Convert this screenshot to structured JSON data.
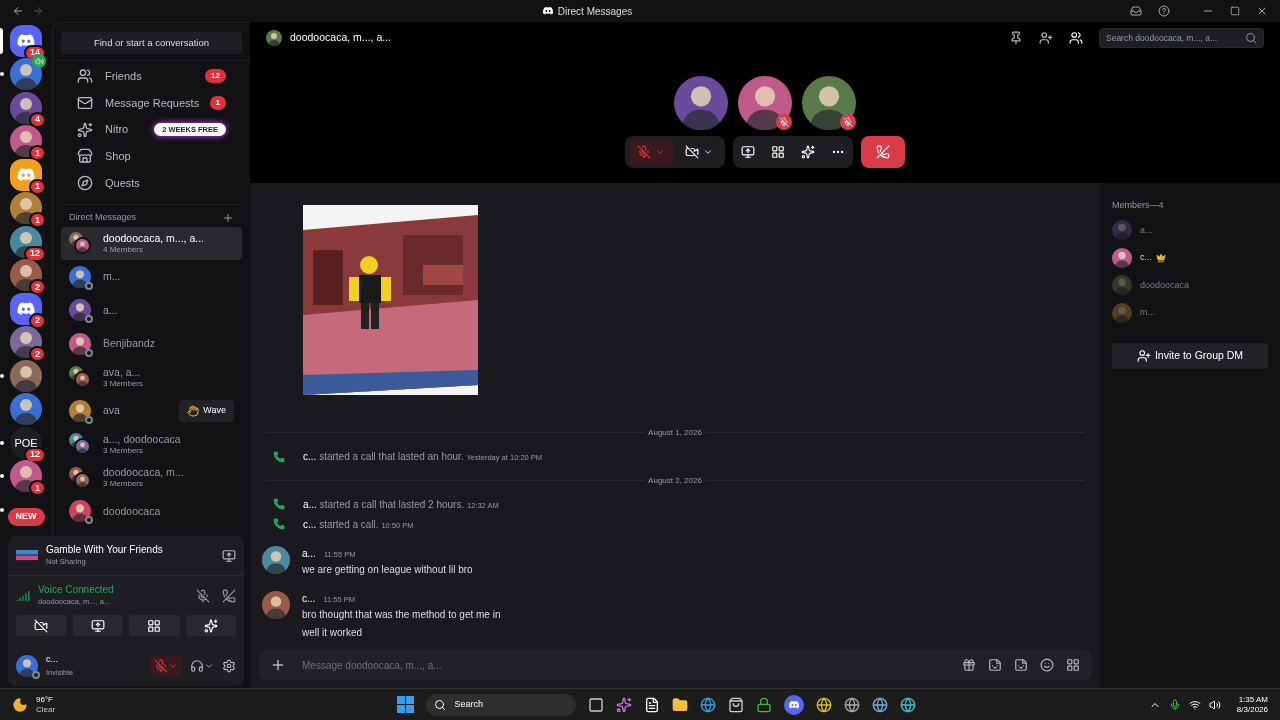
{
  "window": {
    "title": "Direct Messages"
  },
  "servers": [
    {
      "kind": "logo",
      "badge": "14",
      "selected": true,
      "unread": false
    },
    {
      "kind": "avatar",
      "selected": false,
      "unread": true,
      "speaking": true
    },
    {
      "kind": "avatar",
      "badge": "4",
      "selected": false,
      "unread": false
    },
    {
      "kind": "avatar",
      "badge": "1",
      "selected": false,
      "unread": false
    },
    {
      "kind": "logo",
      "badge": "1",
      "selected": false,
      "unread": false,
      "color": "#f0a020"
    },
    {
      "kind": "avatar",
      "badge": "1",
      "selected": false,
      "unread": false
    },
    {
      "kind": "avatar",
      "badge": "12",
      "selected": false,
      "unread": false
    },
    {
      "kind": "avatar",
      "badge": "2",
      "selected": false,
      "unread": false
    },
    {
      "kind": "logo",
      "badge": "2",
      "selected": false,
      "unread": false,
      "color": "#5865f2"
    },
    {
      "kind": "avatar",
      "badge": "2",
      "selected": false,
      "unread": false
    },
    {
      "kind": "avatar",
      "selected": false,
      "unread": true
    },
    {
      "kind": "avatar",
      "selected": false,
      "unread": false
    },
    {
      "kind": "text",
      "label": "POE",
      "badge": "12",
      "selected": false,
      "unread": true
    },
    {
      "kind": "avatar",
      "badge": "1",
      "selected": false,
      "unread": true
    },
    {
      "kind": "new",
      "label": "NEW",
      "selected": false,
      "unread": true
    }
  ],
  "find_button": "Find or start a conversation",
  "nav": [
    {
      "kind": "friends",
      "label": "Friends",
      "count": "12"
    },
    {
      "kind": "requests",
      "label": "Message Requests",
      "count": "1"
    },
    {
      "kind": "nitro",
      "label": "Nitro",
      "promo": "2 WEEKS FREE"
    },
    {
      "kind": "shop",
      "label": "Shop"
    },
    {
      "kind": "quests",
      "label": "Quests"
    }
  ],
  "dm_heading": "Direct Messages",
  "dms": [
    {
      "name": "doodoocaca, m..., a...",
      "subtitle": "4 Members",
      "group": true,
      "selected": true
    },
    {
      "name": "m...",
      "group": false,
      "selected": false
    },
    {
      "name": "a...",
      "group": false,
      "selected": false
    },
    {
      "name": "Benjibandz",
      "group": false,
      "selected": false
    },
    {
      "name": "ava, a...",
      "subtitle": "3 Members",
      "group": true,
      "selected": false
    },
    {
      "name": "ava",
      "group": false,
      "selected": false,
      "action": "Wave"
    },
    {
      "name": "a..., doodoocaca",
      "subtitle": "3 Members",
      "group": true,
      "selected": false
    },
    {
      "name": "doodoocaca, m...",
      "subtitle": "3 Members",
      "group": true,
      "selected": false
    },
    {
      "name": "doodoocaca",
      "group": false,
      "selected": false
    }
  ],
  "activity": {
    "title": "Gamble With Your Friends",
    "status": "Not Sharing"
  },
  "voice": {
    "status": "Voice Connected",
    "channel": "doodoocaca, m..., a..."
  },
  "user": {
    "name": "c...",
    "status": "Invisible",
    "muted": true
  },
  "header": {
    "title": "doodoocaca, m..., a...",
    "search_placeholder": "Search doodoocaca, m..., a..."
  },
  "call": {
    "participants": [
      {
        "muted": false
      },
      {
        "muted": true
      },
      {
        "muted": true
      }
    ],
    "mic_muted": true
  },
  "chat": [
    {
      "kind": "picture"
    },
    {
      "kind": "divider",
      "text": "August 1, 2026"
    },
    {
      "kind": "call",
      "author": "c...",
      "text": "started a call that lasted an hour.",
      "time": "Yesterday at 10:20 PM"
    },
    {
      "kind": "divider",
      "text": "August 2, 2026"
    },
    {
      "kind": "call",
      "author": "a...",
      "text": "started a call that lasted 2 hours.",
      "time": "12:32 AM"
    },
    {
      "kind": "call",
      "author": "c...",
      "text": "started a call.",
      "time": "10:50 PM"
    },
    {
      "kind": "message",
      "author": "a...",
      "time": "11:55 PM",
      "lines": [
        "we are getting on league without lil bro"
      ]
    },
    {
      "kind": "message",
      "author": "c...",
      "time": "11:55 PM",
      "lines": [
        "bro thought that was the method to get me in",
        "well it worked"
      ]
    }
  ],
  "composer": {
    "placeholder": "Message doodoocaca, m..., a..."
  },
  "members": {
    "title": "Members—4",
    "items": [
      {
        "name": "a...",
        "offline": true,
        "owner": false
      },
      {
        "name": "c...",
        "offline": false,
        "owner": true
      },
      {
        "name": "doodoocaca",
        "offline": true,
        "owner": false
      },
      {
        "name": "m...",
        "offline": true,
        "owner": false
      }
    ],
    "invite": "Invite to Group DM"
  },
  "taskbar": {
    "temperature": "96°F",
    "weather": "Clear",
    "search": "Search",
    "time": "1:35 AM",
    "date": "8/3/2026"
  }
}
